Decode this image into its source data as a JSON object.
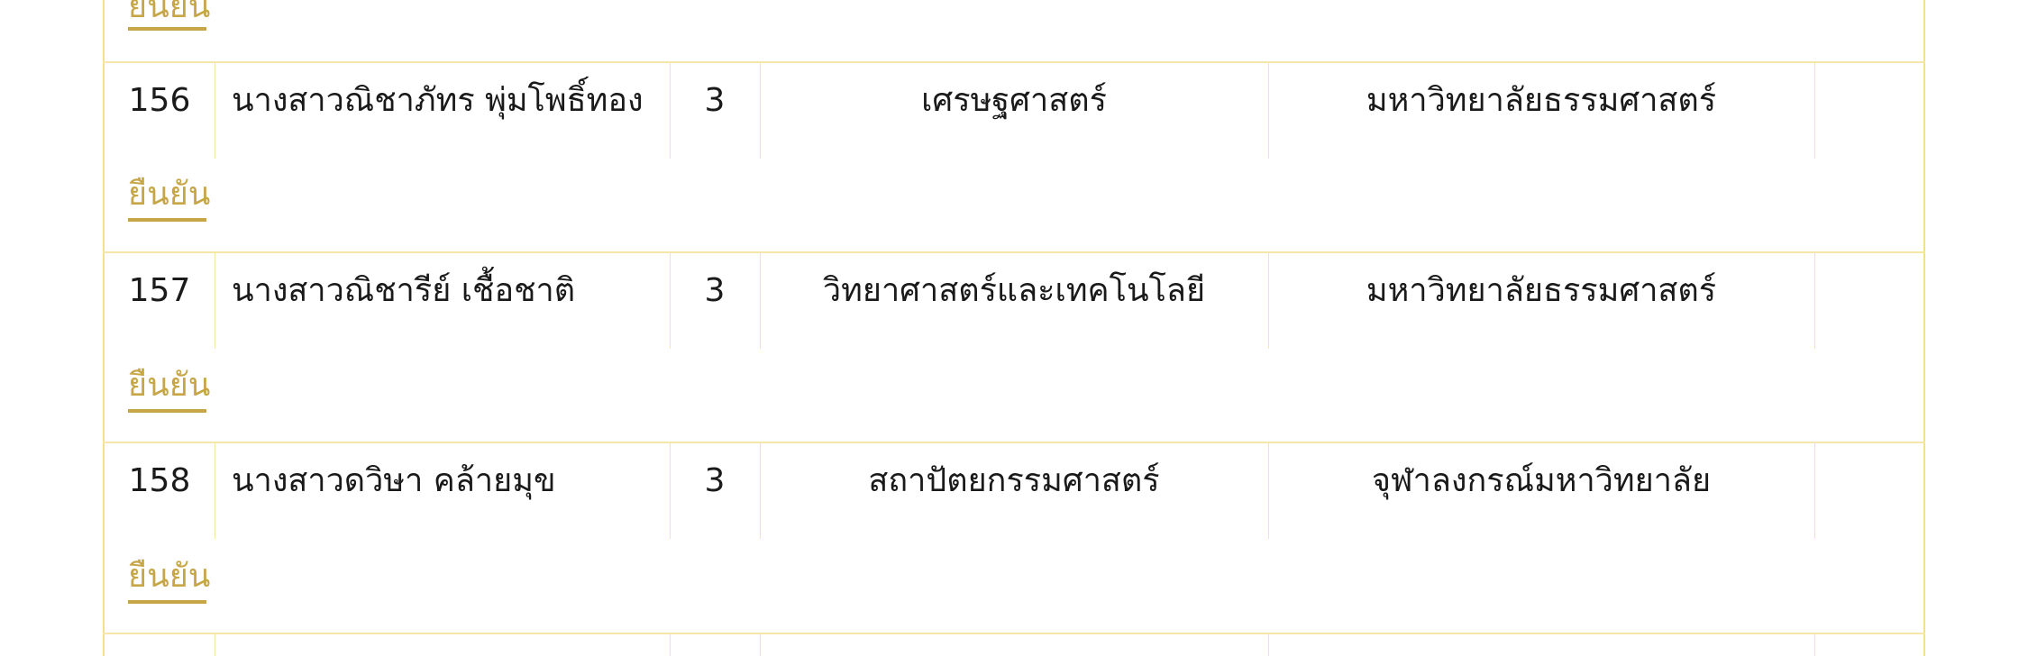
{
  "table": {
    "partial_top_action": "ยืนยัน",
    "rows": [
      {
        "no": "156",
        "name": "นางสาวณิชาภัทร พุ่มโพธิ์ทอง",
        "year": "3",
        "faculty": "เศรษฐศาสตร์",
        "university": "มหาวิทยาลัยธรรมศาสตร์",
        "action": "ยืนยัน"
      },
      {
        "no": "157",
        "name": "นางสาวณิชารีย์ เชื้อชาติ",
        "year": "3",
        "faculty": "วิทยาศาสตร์และเทคโนโลยี",
        "university": "มหาวิทยาลัยธรรมศาสตร์",
        "action": "ยืนยัน"
      },
      {
        "no": "158",
        "name": "นางสาวดวิษา คล้ายมุข",
        "year": "3",
        "faculty": "สถาปัตยกรรมศาสตร์",
        "university": "จุฬาลงกรณ์มหาวิทยาลัย",
        "action": "ยืนยัน"
      }
    ]
  },
  "colors": {
    "border": "#f3df8e",
    "accent": "#c6a647",
    "text": "#1a1a1a",
    "background": "#ffffff"
  }
}
